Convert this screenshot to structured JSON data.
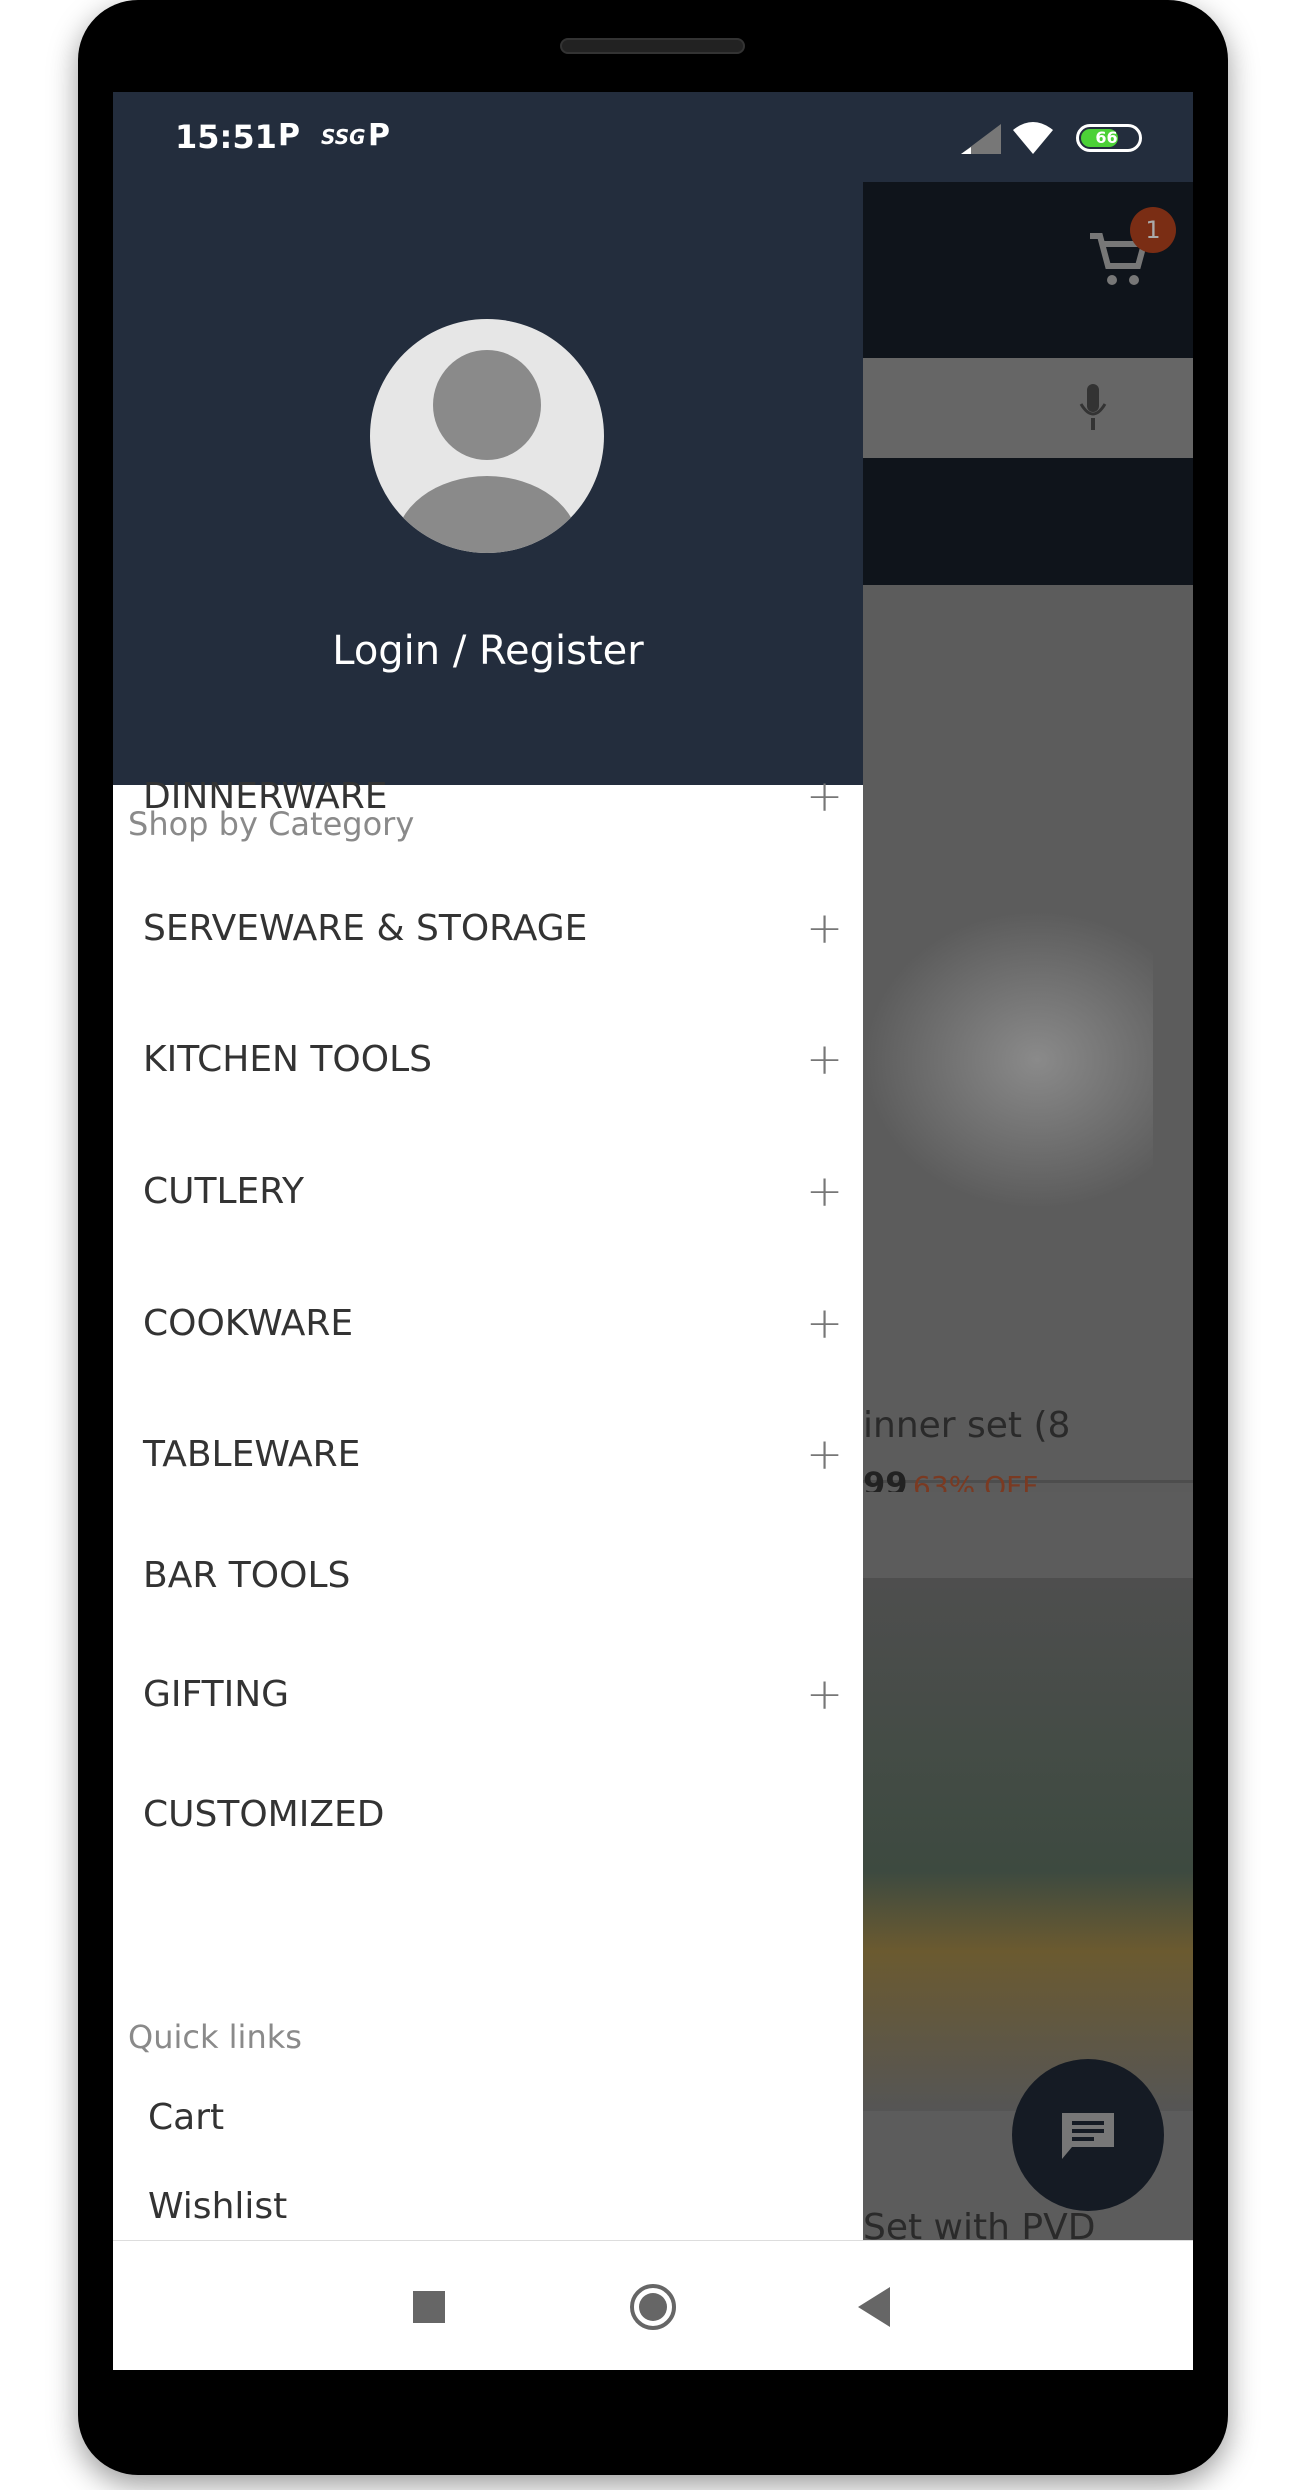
{
  "status_bar": {
    "time": "15:51",
    "icons": [
      "parking-icon",
      "ssg-icon",
      "parking-icon"
    ],
    "battery": "66",
    "signal": "signal-icon",
    "wifi": "wifi-icon"
  },
  "background": {
    "cart_badge": "1",
    "product_title": "inner set (8",
    "product_price": "99",
    "product_discount": "63% OFF",
    "product2_title": "Set with PVD"
  },
  "drawer": {
    "login_label": "Login / Register",
    "category_heading": "Shop by Category",
    "categories": [
      {
        "label": "DINNERWARE",
        "expandable": true
      },
      {
        "label": "SERVEWARE & STORAGE",
        "expandable": true
      },
      {
        "label": "KITCHEN TOOLS",
        "expandable": true
      },
      {
        "label": "CUTLERY",
        "expandable": true
      },
      {
        "label": "COOKWARE",
        "expandable": true
      },
      {
        "label": "TABLEWARE",
        "expandable": true
      },
      {
        "label": "BAR TOOLS",
        "expandable": false
      },
      {
        "label": "GIFTING",
        "expandable": true
      },
      {
        "label": "CUSTOMIZED",
        "expandable": false
      }
    ],
    "quick_links_heading": "Quick links",
    "quick_links": [
      "Cart",
      "Wishlist"
    ]
  },
  "colors": {
    "header": "#232d3d",
    "badge": "#c0471f",
    "discount": "#c0471f",
    "battery": "#4cd137"
  }
}
